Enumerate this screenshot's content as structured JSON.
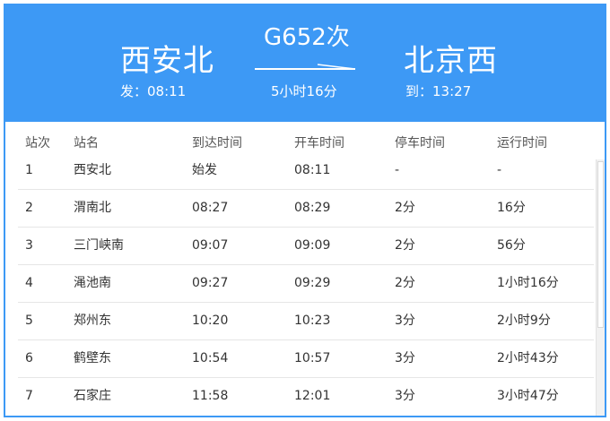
{
  "header": {
    "from_station": "西安北",
    "to_station": "北京西",
    "train_number": "G652次",
    "depart_time": "发：08:11",
    "arrive_time": "到：13:27",
    "duration": "5小时16分",
    "color": "#3d99f5"
  },
  "table": {
    "columns": [
      "站次",
      "站名",
      "到达时间",
      "开车时间",
      "停车时间",
      "运行时间"
    ],
    "rows": [
      [
        "1",
        "西安北",
        "始发",
        "08:11",
        "-",
        "-"
      ],
      [
        "2",
        "渭南北",
        "08:27",
        "08:29",
        "2分",
        "16分"
      ],
      [
        "3",
        "三门峡南",
        "09:07",
        "09:09",
        "2分",
        "56分"
      ],
      [
        "4",
        "渑池南",
        "09:27",
        "09:29",
        "2分",
        "1小时16分"
      ],
      [
        "5",
        "郑州东",
        "10:20",
        "10:23",
        "3分",
        "2小时9分"
      ],
      [
        "6",
        "鹤壁东",
        "10:54",
        "10:57",
        "3分",
        "2小时43分"
      ],
      [
        "7",
        "石家庄",
        "11:58",
        "12:01",
        "3分",
        "3小时47分"
      ]
    ]
  }
}
